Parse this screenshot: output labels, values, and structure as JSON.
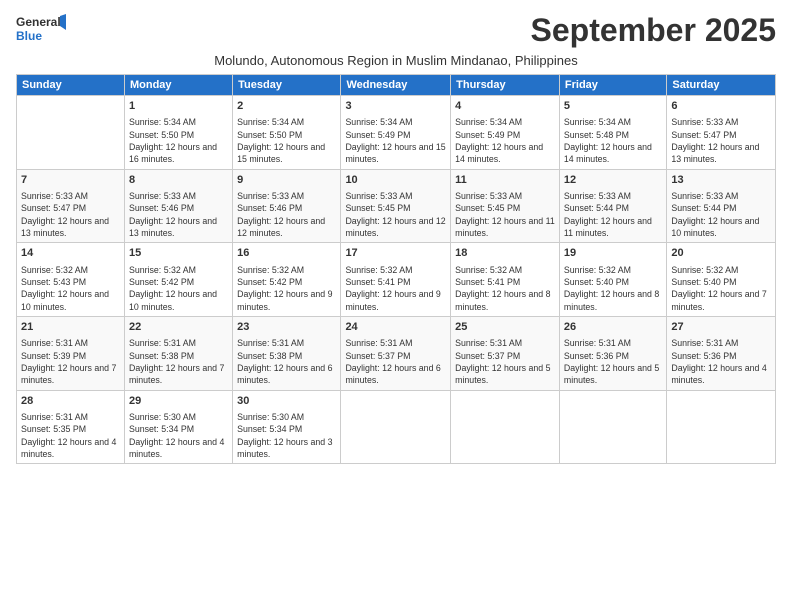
{
  "logo": {
    "line1": "General",
    "line2": "Blue"
  },
  "title": "September 2025",
  "subtitle": "Molundo, Autonomous Region in Muslim Mindanao, Philippines",
  "days_of_week": [
    "Sunday",
    "Monday",
    "Tuesday",
    "Wednesday",
    "Thursday",
    "Friday",
    "Saturday"
  ],
  "weeks": [
    [
      {
        "day": "",
        "sunrise": "",
        "sunset": "",
        "daylight": "",
        "empty": true
      },
      {
        "day": "1",
        "sunrise": "Sunrise: 5:34 AM",
        "sunset": "Sunset: 5:50 PM",
        "daylight": "Daylight: 12 hours and 16 minutes."
      },
      {
        "day": "2",
        "sunrise": "Sunrise: 5:34 AM",
        "sunset": "Sunset: 5:50 PM",
        "daylight": "Daylight: 12 hours and 15 minutes."
      },
      {
        "day": "3",
        "sunrise": "Sunrise: 5:34 AM",
        "sunset": "Sunset: 5:49 PM",
        "daylight": "Daylight: 12 hours and 15 minutes."
      },
      {
        "day": "4",
        "sunrise": "Sunrise: 5:34 AM",
        "sunset": "Sunset: 5:49 PM",
        "daylight": "Daylight: 12 hours and 14 minutes."
      },
      {
        "day": "5",
        "sunrise": "Sunrise: 5:34 AM",
        "sunset": "Sunset: 5:48 PM",
        "daylight": "Daylight: 12 hours and 14 minutes."
      },
      {
        "day": "6",
        "sunrise": "Sunrise: 5:33 AM",
        "sunset": "Sunset: 5:47 PM",
        "daylight": "Daylight: 12 hours and 13 minutes."
      }
    ],
    [
      {
        "day": "7",
        "sunrise": "Sunrise: 5:33 AM",
        "sunset": "Sunset: 5:47 PM",
        "daylight": "Daylight: 12 hours and 13 minutes."
      },
      {
        "day": "8",
        "sunrise": "Sunrise: 5:33 AM",
        "sunset": "Sunset: 5:46 PM",
        "daylight": "Daylight: 12 hours and 13 minutes."
      },
      {
        "day": "9",
        "sunrise": "Sunrise: 5:33 AM",
        "sunset": "Sunset: 5:46 PM",
        "daylight": "Daylight: 12 hours and 12 minutes."
      },
      {
        "day": "10",
        "sunrise": "Sunrise: 5:33 AM",
        "sunset": "Sunset: 5:45 PM",
        "daylight": "Daylight: 12 hours and 12 minutes."
      },
      {
        "day": "11",
        "sunrise": "Sunrise: 5:33 AM",
        "sunset": "Sunset: 5:45 PM",
        "daylight": "Daylight: 12 hours and 11 minutes."
      },
      {
        "day": "12",
        "sunrise": "Sunrise: 5:33 AM",
        "sunset": "Sunset: 5:44 PM",
        "daylight": "Daylight: 12 hours and 11 minutes."
      },
      {
        "day": "13",
        "sunrise": "Sunrise: 5:33 AM",
        "sunset": "Sunset: 5:44 PM",
        "daylight": "Daylight: 12 hours and 10 minutes."
      }
    ],
    [
      {
        "day": "14",
        "sunrise": "Sunrise: 5:32 AM",
        "sunset": "Sunset: 5:43 PM",
        "daylight": "Daylight: 12 hours and 10 minutes."
      },
      {
        "day": "15",
        "sunrise": "Sunrise: 5:32 AM",
        "sunset": "Sunset: 5:42 PM",
        "daylight": "Daylight: 12 hours and 10 minutes."
      },
      {
        "day": "16",
        "sunrise": "Sunrise: 5:32 AM",
        "sunset": "Sunset: 5:42 PM",
        "daylight": "Daylight: 12 hours and 9 minutes."
      },
      {
        "day": "17",
        "sunrise": "Sunrise: 5:32 AM",
        "sunset": "Sunset: 5:41 PM",
        "daylight": "Daylight: 12 hours and 9 minutes."
      },
      {
        "day": "18",
        "sunrise": "Sunrise: 5:32 AM",
        "sunset": "Sunset: 5:41 PM",
        "daylight": "Daylight: 12 hours and 8 minutes."
      },
      {
        "day": "19",
        "sunrise": "Sunrise: 5:32 AM",
        "sunset": "Sunset: 5:40 PM",
        "daylight": "Daylight: 12 hours and 8 minutes."
      },
      {
        "day": "20",
        "sunrise": "Sunrise: 5:32 AM",
        "sunset": "Sunset: 5:40 PM",
        "daylight": "Daylight: 12 hours and 7 minutes."
      }
    ],
    [
      {
        "day": "21",
        "sunrise": "Sunrise: 5:31 AM",
        "sunset": "Sunset: 5:39 PM",
        "daylight": "Daylight: 12 hours and 7 minutes."
      },
      {
        "day": "22",
        "sunrise": "Sunrise: 5:31 AM",
        "sunset": "Sunset: 5:38 PM",
        "daylight": "Daylight: 12 hours and 7 minutes."
      },
      {
        "day": "23",
        "sunrise": "Sunrise: 5:31 AM",
        "sunset": "Sunset: 5:38 PM",
        "daylight": "Daylight: 12 hours and 6 minutes."
      },
      {
        "day": "24",
        "sunrise": "Sunrise: 5:31 AM",
        "sunset": "Sunset: 5:37 PM",
        "daylight": "Daylight: 12 hours and 6 minutes."
      },
      {
        "day": "25",
        "sunrise": "Sunrise: 5:31 AM",
        "sunset": "Sunset: 5:37 PM",
        "daylight": "Daylight: 12 hours and 5 minutes."
      },
      {
        "day": "26",
        "sunrise": "Sunrise: 5:31 AM",
        "sunset": "Sunset: 5:36 PM",
        "daylight": "Daylight: 12 hours and 5 minutes."
      },
      {
        "day": "27",
        "sunrise": "Sunrise: 5:31 AM",
        "sunset": "Sunset: 5:36 PM",
        "daylight": "Daylight: 12 hours and 4 minutes."
      }
    ],
    [
      {
        "day": "28",
        "sunrise": "Sunrise: 5:31 AM",
        "sunset": "Sunset: 5:35 PM",
        "daylight": "Daylight: 12 hours and 4 minutes."
      },
      {
        "day": "29",
        "sunrise": "Sunrise: 5:30 AM",
        "sunset": "Sunset: 5:34 PM",
        "daylight": "Daylight: 12 hours and 4 minutes."
      },
      {
        "day": "30",
        "sunrise": "Sunrise: 5:30 AM",
        "sunset": "Sunset: 5:34 PM",
        "daylight": "Daylight: 12 hours and 3 minutes."
      },
      {
        "day": "",
        "empty": true
      },
      {
        "day": "",
        "empty": true
      },
      {
        "day": "",
        "empty": true
      },
      {
        "day": "",
        "empty": true
      }
    ]
  ]
}
